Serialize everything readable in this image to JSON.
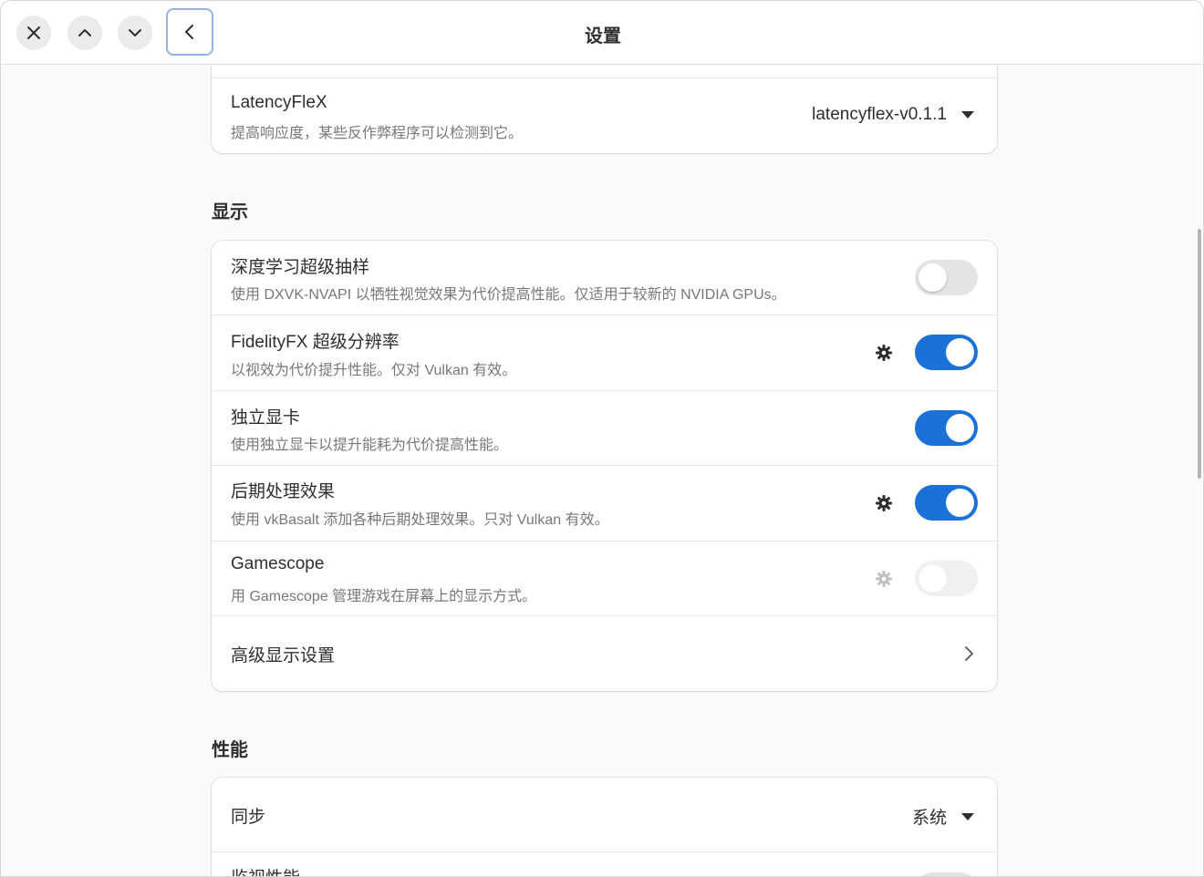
{
  "window": {
    "title": "设置"
  },
  "header": {
    "close_icon": "close-icon",
    "up_icon": "chevron-up-icon",
    "down_icon": "chevron-down-icon",
    "back_icon": "chevron-left-icon"
  },
  "latency_row": {
    "title": "LatencyFleX",
    "subtitle": "提高响应度，某些反作弊程序可以检测到它。",
    "dropdown_value": "latencyflex-v0.1.1"
  },
  "display": {
    "section_title": "显示",
    "rows": [
      {
        "title": "深度学习超级抽样",
        "subtitle": "使用 DXVK-NVAPI 以牺牲视觉效果为代价提高性能。仅适用于较新的 NVIDIA GPUs。",
        "switch_on": false,
        "has_gear": false,
        "disabled": false
      },
      {
        "title": "FidelityFX 超级分辨率",
        "subtitle": "以视效为代价提升性能。仅对 Vulkan 有效。",
        "switch_on": true,
        "has_gear": true,
        "disabled": false
      },
      {
        "title": "独立显卡",
        "subtitle": "使用独立显卡以提升能耗为代价提高性能。",
        "switch_on": true,
        "has_gear": false,
        "disabled": false
      },
      {
        "title": "后期处理效果",
        "subtitle": "使用 vkBasalt 添加各种后期处理效果。只对 Vulkan 有效。",
        "switch_on": true,
        "has_gear": true,
        "disabled": false
      },
      {
        "title": "Gamescope",
        "subtitle": "用 Gamescope 管理游戏在屏幕上的显示方式。",
        "switch_on": false,
        "has_gear": true,
        "disabled": true
      }
    ],
    "advanced_label": "高级显示设置"
  },
  "performance": {
    "section_title": "性能",
    "sync_label": "同步",
    "sync_value": "系统",
    "monitor_label": "监视性能"
  },
  "colors": {
    "accent": "#1c71d8",
    "switch_off": "#e4e4e4",
    "subtitle": "#777777"
  }
}
